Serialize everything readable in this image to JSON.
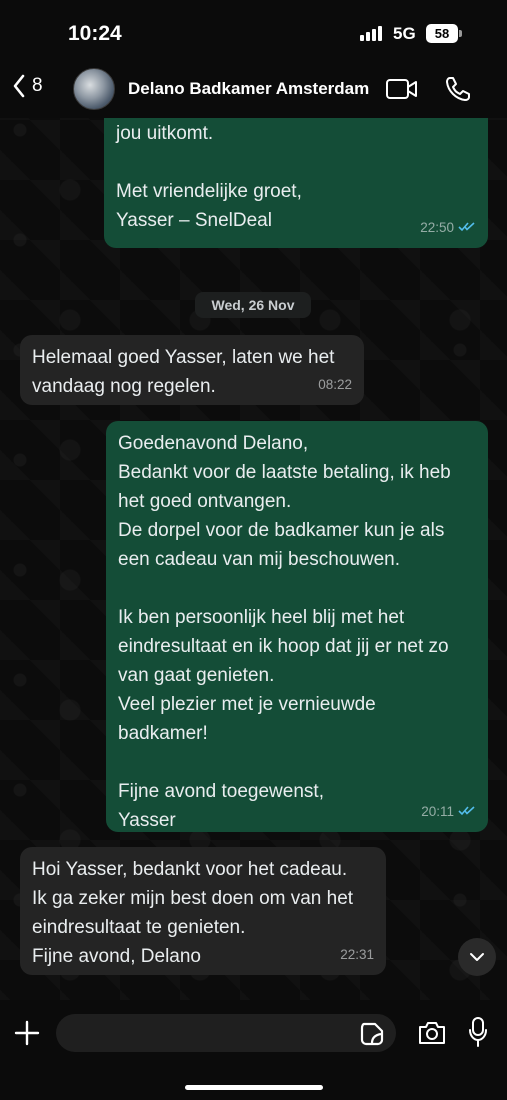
{
  "status_bar": {
    "time": "10:24",
    "network": "5G",
    "battery": "58"
  },
  "header": {
    "back_count": "8",
    "contact_name": "Delano Badkamer Amsterdam",
    "icons": [
      "back-chevron-icon",
      "video-call-icon",
      "phone-icon"
    ]
  },
  "chat": {
    "messages": [
      {
        "direction": "outgoing",
        "text": "Laat even weten welke dag en tijd voor\njou uitkomt.\n\nMet vriendelijke groet,\nYasser – SnelDeal",
        "time": "22:50",
        "read": true
      },
      {
        "direction": "incoming",
        "text": "Helemaal goed Yasser, laten we het\nvandaag nog regelen.",
        "time": "08:22"
      },
      {
        "direction": "outgoing",
        "text": "Goedenavond Delano,\nBedankt voor de laatste betaling, ik heb\nhet goed ontvangen.\nDe dorpel voor de badkamer kun je als\neen cadeau van mij beschouwen.\n\nIk ben persoonlijk heel blij met het\neindresultaat en ik hoop dat jij er net zo\nvan gaat genieten.\nVeel plezier met je vernieuwde\nbadkamer!\n\nFijne avond toegewenst,\nYasser",
        "time": "20:11",
        "read": true
      },
      {
        "direction": "incoming",
        "text": "Hoi Yasser, bedankt voor het cadeau.\nIk ga zeker mijn best doen om van het\neindresultaat te genieten.\nFijne avond, Delano",
        "time": "22:31"
      }
    ],
    "date_divider": "Wed, 26 Nov"
  },
  "input_bar": {
    "placeholder": "",
    "icons": [
      "plus-icon",
      "sticker-icon",
      "camera-icon",
      "microphone-icon"
    ]
  },
  "colors": {
    "outgoing_bubble": "#144d37",
    "incoming_bubble": "#242424",
    "read_ticks": "#53bdeb",
    "background": "#0b0b0b"
  }
}
